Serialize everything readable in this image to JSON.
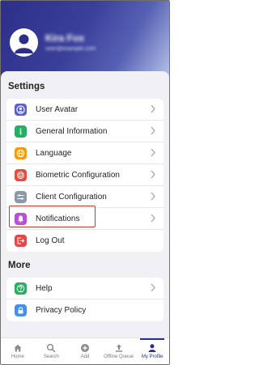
{
  "profile": {
    "name": "Kira Fox",
    "email": "user@example.com"
  },
  "settings": {
    "title": "Settings",
    "items": [
      {
        "label": "User Avatar",
        "icon": "user-avatar-icon",
        "color": "#5a62c7"
      },
      {
        "label": "General Information",
        "icon": "info-icon",
        "color": "#27ae60"
      },
      {
        "label": "Language",
        "icon": "globe-icon",
        "color": "#f39c12"
      },
      {
        "label": "Biometric Configuration",
        "icon": "fingerprint-icon",
        "color": "#e74c3c"
      },
      {
        "label": "Client Configuration",
        "icon": "sliders-icon",
        "color": "#8e99a8"
      },
      {
        "label": "Notifications",
        "icon": "bell-icon",
        "color": "#b84fd6"
      },
      {
        "label": "Log Out",
        "icon": "logout-icon",
        "color": "#e8474a"
      }
    ]
  },
  "more": {
    "title": "More",
    "items": [
      {
        "label": "Help",
        "icon": "help-icon",
        "color": "#27ae60"
      },
      {
        "label": "Privacy Policy",
        "icon": "lock-icon",
        "color": "#4a8fe7"
      }
    ]
  },
  "tabbar": {
    "items": [
      {
        "label": "Home",
        "icon": "home-icon"
      },
      {
        "label": "Search",
        "icon": "search-icon"
      },
      {
        "label": "Add",
        "icon": "add-icon"
      },
      {
        "label": "Offline Queue",
        "icon": "upload-icon"
      },
      {
        "label": "My Profile",
        "icon": "profile-icon"
      }
    ],
    "active": "My Profile"
  },
  "colors": {
    "brand": "#2c2f88",
    "highlight": "#c0392b"
  }
}
